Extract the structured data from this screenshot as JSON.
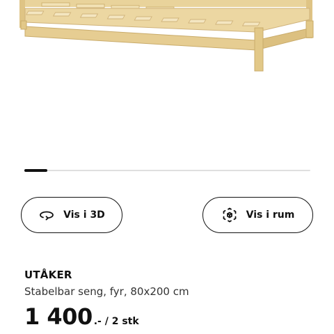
{
  "product": {
    "name": "UTÅKER",
    "description": "Stabelbar seng, fyr, 80x200 cm",
    "price": "1 400",
    "price_dash": ".-",
    "price_unit": " / 2 stk"
  },
  "carousel": {
    "current_position": 0.08
  },
  "actions": {
    "view_3d": {
      "label": "Vis i 3D",
      "icon": "rotate-3d-icon"
    },
    "view_room": {
      "label": "Vis i rum",
      "icon": "ar-cube-icon"
    }
  },
  "colors": {
    "wood": "#e9d39b",
    "text": "#111111",
    "track": "#dfdfdf"
  }
}
